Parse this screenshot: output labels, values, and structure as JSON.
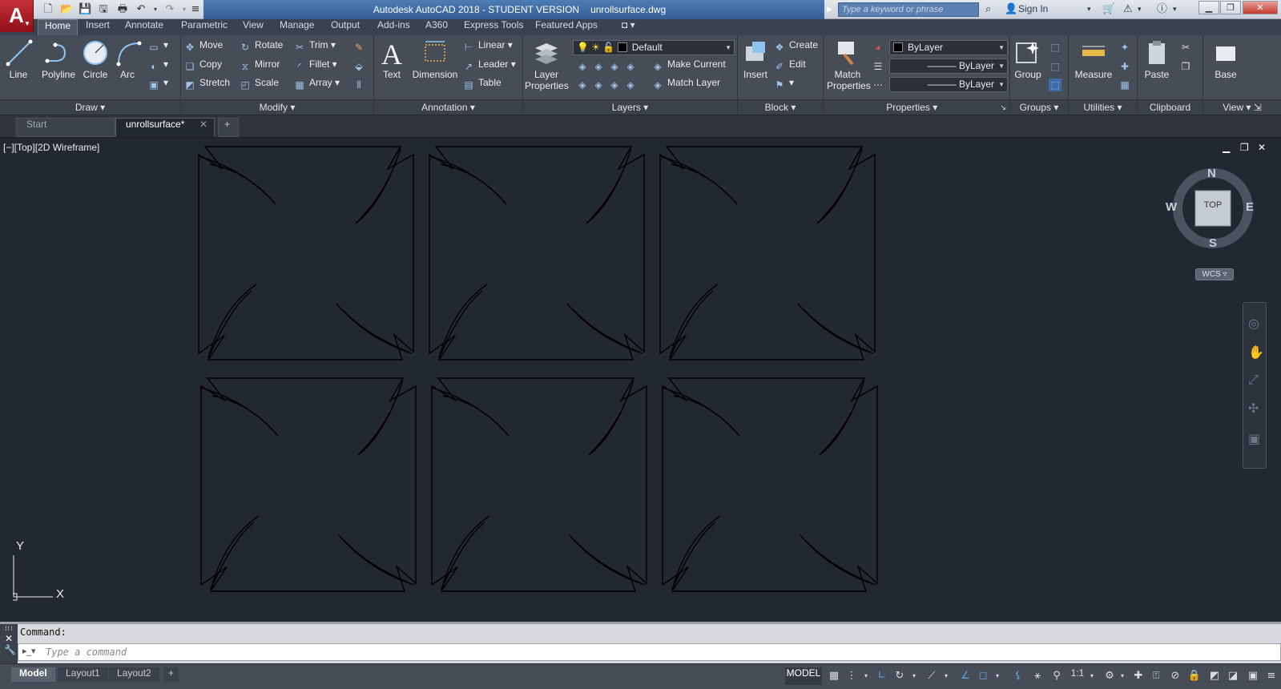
{
  "app": {
    "title": "Autodesk AutoCAD 2018 - STUDENT VERSION",
    "filename": "unrollsurface.dwg",
    "logo_letter": "A",
    "search_placeholder": "Type a keyword or phrase",
    "signin_label": "Sign In"
  },
  "ribbon_tabs": [
    "Home",
    "Insert",
    "Annotate",
    "Parametric",
    "View",
    "Manage",
    "Output",
    "Add-ins",
    "A360",
    "Express Tools",
    "Featured Apps"
  ],
  "panels": {
    "draw": {
      "title": "Draw",
      "line": "Line",
      "polyline": "Polyline",
      "circle": "Circle",
      "arc": "Arc"
    },
    "modify": {
      "title": "Modify",
      "move": "Move",
      "rotate": "Rotate",
      "trim": "Trim",
      "copy": "Copy",
      "mirror": "Mirror",
      "fillet": "Fillet",
      "stretch": "Stretch",
      "scale": "Scale",
      "array": "Array"
    },
    "annotation": {
      "title": "Annotation",
      "text": "Text",
      "dimension": "Dimension",
      "linear": "Linear",
      "leader": "Leader",
      "table": "Table"
    },
    "layers": {
      "title": "Layers",
      "layer_properties_1": "Layer",
      "layer_properties_2": "Properties",
      "current_layer": "Default",
      "make_current": "Make Current",
      "match_layer": "Match Layer"
    },
    "block": {
      "title": "Block",
      "insert": "Insert",
      "create": "Create",
      "edit": "Edit"
    },
    "properties": {
      "title": "Properties",
      "match_1": "Match",
      "match_2": "Properties",
      "color": "ByLayer",
      "linetype": "ByLayer",
      "lineweight": "ByLayer"
    },
    "groups": {
      "title": "Groups",
      "group": "Group"
    },
    "utilities": {
      "title": "Utilities",
      "measure": "Measure"
    },
    "clipboard": {
      "title": "Clipboard",
      "paste": "Paste"
    },
    "view": {
      "title": "View",
      "base": "Base"
    }
  },
  "doc_tabs": {
    "start": "Start",
    "active": "unrollsurface*"
  },
  "viewport": {
    "label": "[−][Top][2D Wireframe]"
  },
  "viewcube": {
    "n": "N",
    "s": "S",
    "e": "E",
    "w": "W",
    "face": "TOP",
    "ucs": "WCS"
  },
  "ucs_icon": {
    "x": "X",
    "y": "Y"
  },
  "command": {
    "prompt": "Command:",
    "placeholder": "Type a command"
  },
  "layout_tabs": {
    "model": "Model",
    "layout1": "Layout1",
    "layout2": "Layout2"
  },
  "status": {
    "model": "MODEL",
    "scale": "1:1"
  },
  "colors": {
    "viewport_bg": "#212830",
    "ribbon_bg": "#474d57",
    "title_blue": "#3d6ba6",
    "logo_red": "#b0202a",
    "geometry": "#000000"
  }
}
